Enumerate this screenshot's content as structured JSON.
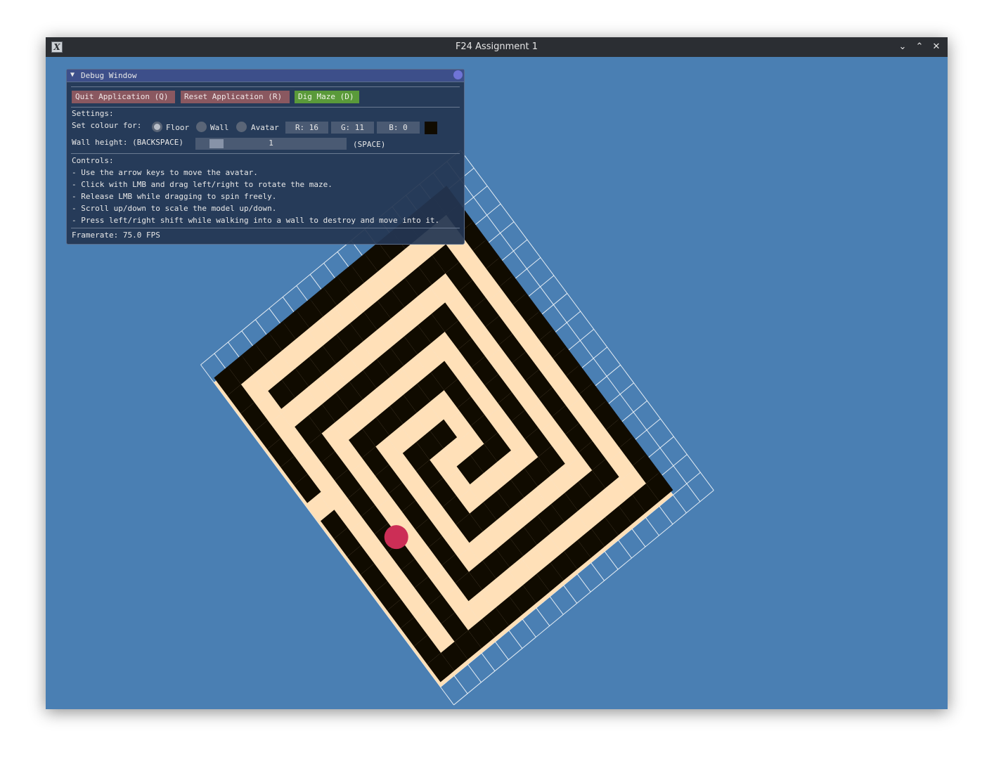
{
  "window": {
    "title": "F24 Assignment 1",
    "app_icon": "X"
  },
  "titlebar_buttons": {
    "minimize_icon": "⌄",
    "maximize_icon": "⌃",
    "close_icon": "✕"
  },
  "debug": {
    "title": "Debug Window",
    "collapse_icon": "▼",
    "buttons": {
      "quit": "Quit Application (Q)",
      "reset": "Reset Application (R)",
      "dig": "Dig Maze (D)"
    },
    "settings_label": "Settings:",
    "colour_label": "Set colour for:",
    "radio_options": [
      "Floor",
      "Wall",
      "Avatar"
    ],
    "radio_selected": "Floor",
    "rgb": {
      "r": "R: 16",
      "g": "G: 11",
      "b": "B:  0"
    },
    "swatch_color": "#100b00",
    "wall_height_label": "Wall height: (BACKSPACE)",
    "wall_height_value": "1",
    "space_label": "(SPACE)",
    "controls_label": "Controls:",
    "controls": [
      "- Use the arrow keys to move the avatar.",
      "- Click with LMB and drag left/right to rotate the maze.",
      "- Release LMB while dragging to spin freely.",
      "- Scroll up/down to scale the model up/down.",
      "- Press left/right shift while walking into a wall to destroy and move into it."
    ],
    "framerate": "Framerate: 75.0 FPS"
  },
  "scene": {
    "background_color": "#4a7fb3",
    "floor_color": "#ffe0b8",
    "wall_color": "#100b00",
    "avatar_color": "#cc2e56",
    "grid_color": "#ffffff",
    "maze_rows": [
      "#################",
      "#...............#",
      "#.#############.#",
      "#.#...........#.#",
      "#.#.#########.#.#",
      "#.#.#.......#.#.#",
      "#.#.#.#####.#.#.#",
      "#.#.#.#...#.#.#.#",
      "#.#.#.#.#.#.#.#.#",
      "#.#.#.#.#...#.#.#",
      "#.#.#.#.#####.#.#",
      "#.#.#.#.......#.#",
      "#.#.#.#########.#",
      "#.#.#...........#",
      "#.#.#############",
      "#...............#",
      "#######.#########"
    ]
  }
}
